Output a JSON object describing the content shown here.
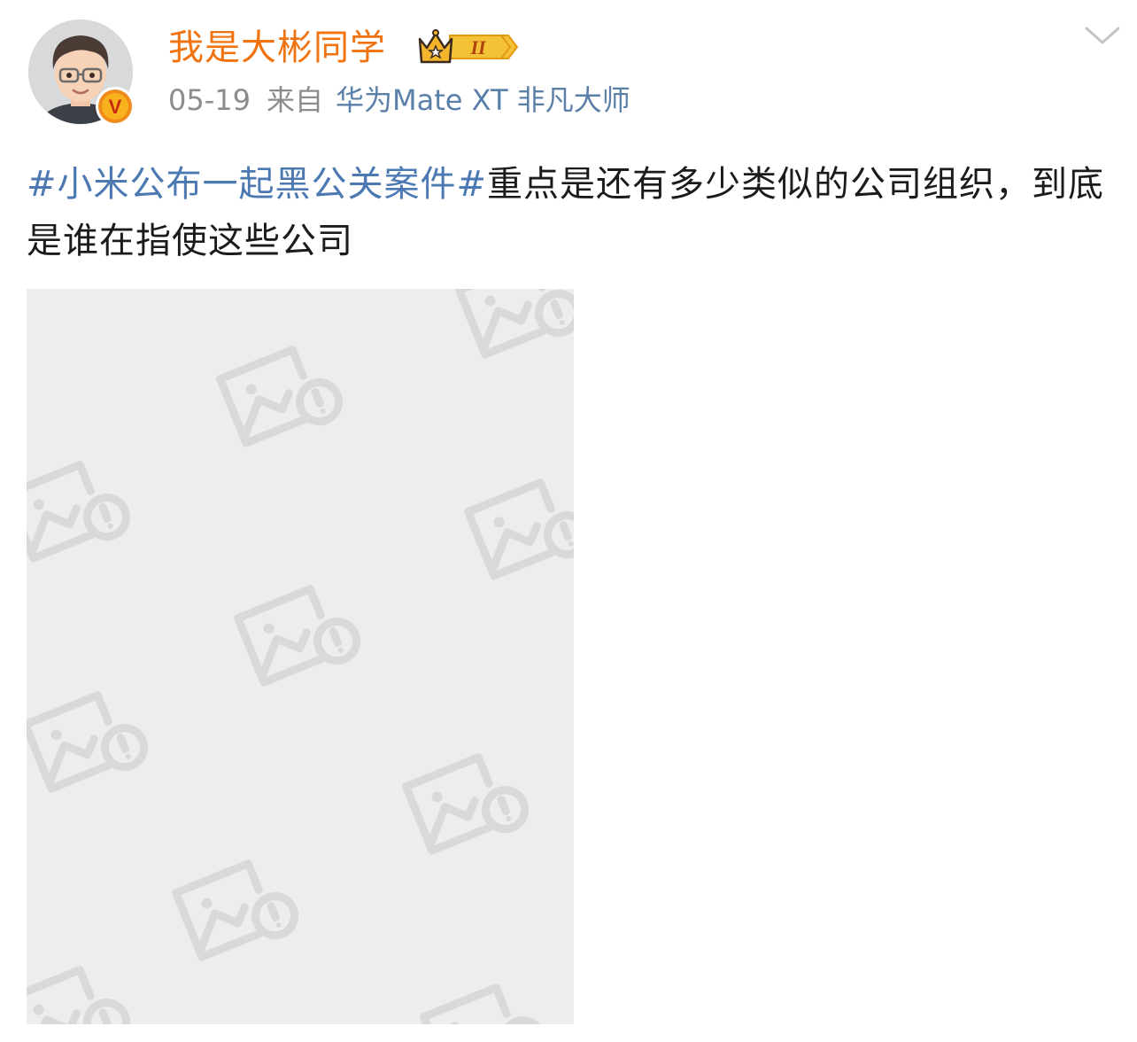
{
  "post": {
    "author": {
      "name": "我是大彬同学",
      "verified_mark": "V",
      "vip_level": "II"
    },
    "date": "05-19",
    "source_prefix": "来自",
    "device": "华为Mate XT 非凡大师",
    "hashtag": "#小米公布一起黑公关案件#",
    "text": "重点是还有多少类似的公司组织，到底是谁在指使这些公司",
    "image": {
      "state": "failed-to-load",
      "icon": "image-broken-icon"
    }
  },
  "icons": {
    "menu": "chevron-down-icon"
  },
  "colors": {
    "username": "#f0730f",
    "hashtag": "#4c79b1",
    "device": "#5a7fa8",
    "meta": "#8c8c8c",
    "placeholder_bg": "#ededed",
    "placeholder_icon": "#d9d9d9",
    "verified": "#f08a1a"
  }
}
